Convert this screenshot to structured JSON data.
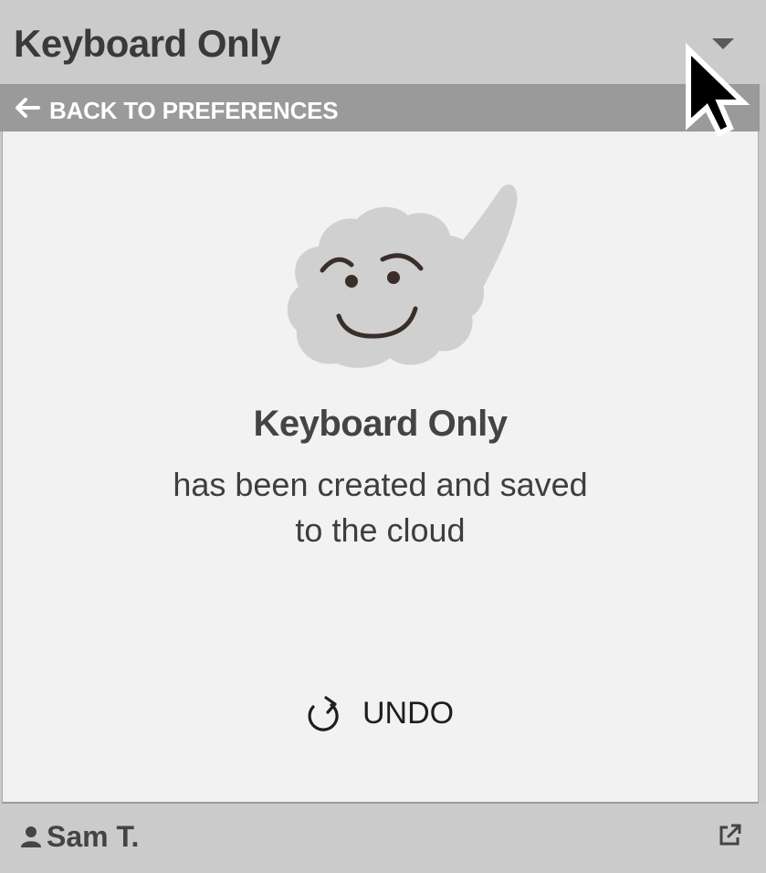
{
  "header": {
    "title": "Keyboard Only",
    "dropdown_icon": "caret-down-icon"
  },
  "back_bar": {
    "label": "BACK TO PREFERENCES",
    "icon": "arrow-left-icon"
  },
  "confirmation": {
    "illustration": "smiling-cloud-icon",
    "title": "Keyboard Only",
    "line1": "has been created and saved",
    "line2": "to the cloud"
  },
  "undo": {
    "label": "UNDO",
    "icon": "undo-icon"
  },
  "footer": {
    "user_name": "Sam T.",
    "user_icon": "user-icon",
    "external_icon": "external-link-icon"
  },
  "colors": {
    "header_bg": "#cbcbcb",
    "back_bar_bg": "#9a9a9a",
    "panel_bg": "#f2f2f2",
    "cloud": "#d0d0d0",
    "face": "#3a2e2a"
  }
}
